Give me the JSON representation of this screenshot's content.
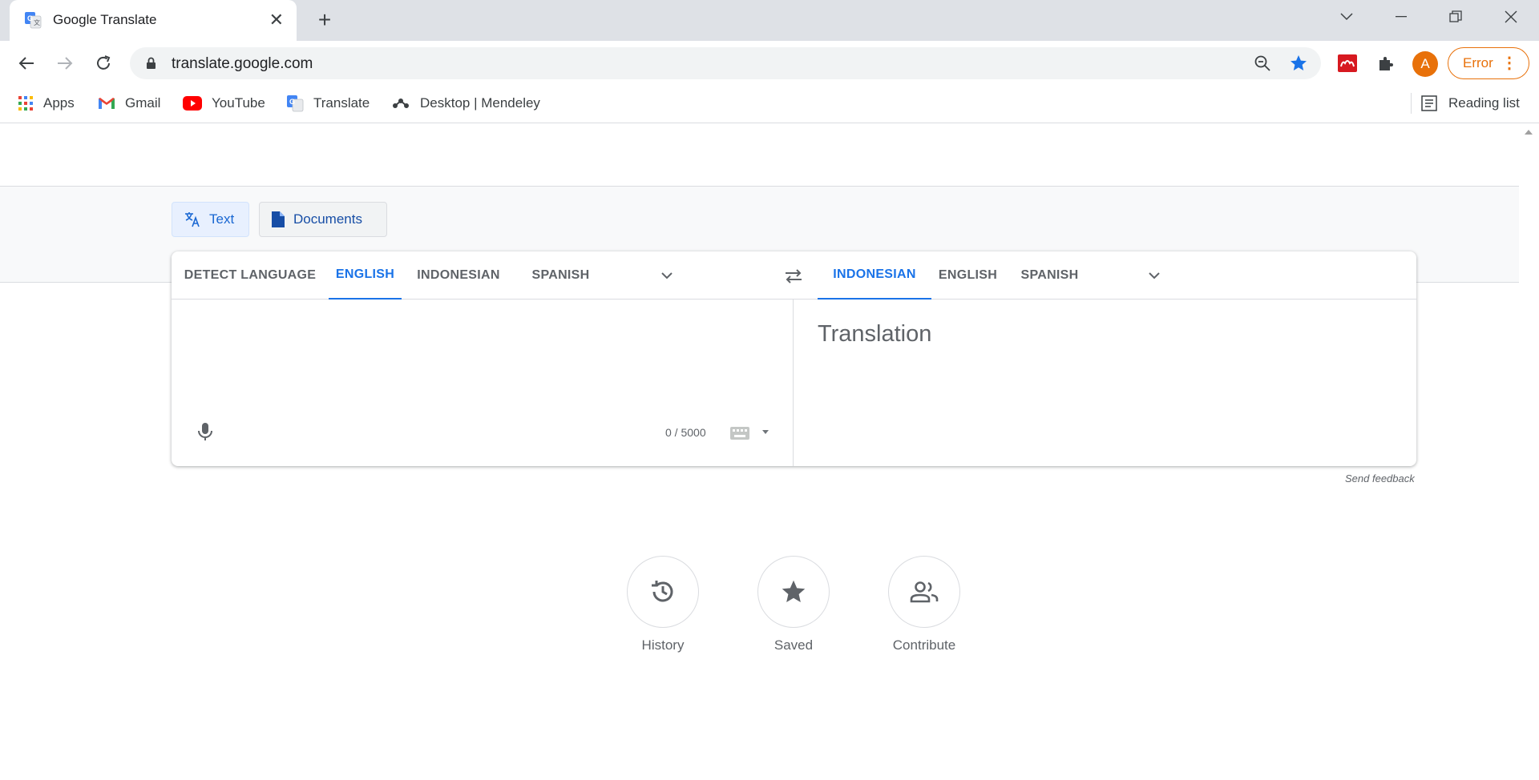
{
  "browser": {
    "tab_title": "Google Translate",
    "url": "translate.google.com",
    "profile_initial": "A",
    "error_label": "Error",
    "bookmarks": [
      {
        "label": "Apps",
        "icon": "apps-grid-icon"
      },
      {
        "label": "Gmail",
        "icon": "gmail-icon"
      },
      {
        "label": "YouTube",
        "icon": "youtube-icon"
      },
      {
        "label": "Translate",
        "icon": "translate-icon"
      },
      {
        "label": "Desktop | Mendeley",
        "icon": "mendeley-icon"
      }
    ],
    "reading_list": "Reading list",
    "colors": {
      "accent": "#1a73e8",
      "profile": "#e8710a",
      "mendeley": "#d71920"
    }
  },
  "translate": {
    "modes": {
      "text": "Text",
      "documents": "Documents"
    },
    "source_langs": [
      "DETECT LANGUAGE",
      "ENGLISH",
      "INDONESIAN",
      "SPANISH"
    ],
    "source_active": "ENGLISH",
    "target_langs": [
      "INDONESIAN",
      "ENGLISH",
      "SPANISH"
    ],
    "target_active": "INDONESIAN",
    "source_text": "",
    "char_count": "0 / 5000",
    "translation_placeholder": "Translation",
    "feedback": "Send feedback",
    "actions": {
      "history": "History",
      "saved": "Saved",
      "contribute": "Contribute"
    }
  }
}
